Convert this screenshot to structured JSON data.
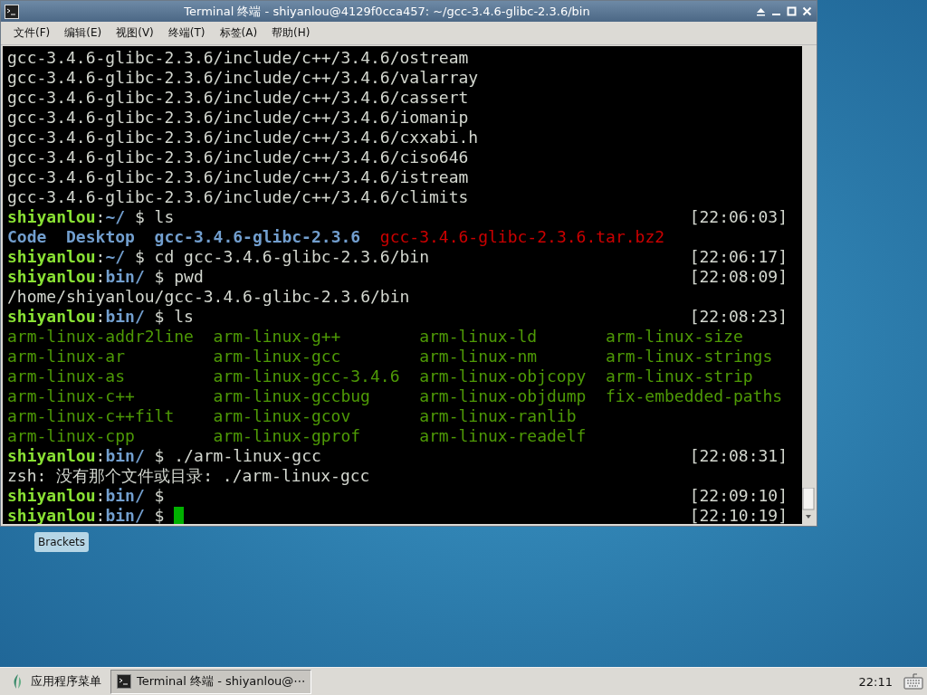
{
  "window": {
    "title": "Terminal 终端 - shiyanlou@4129f0cca457: ~/gcc-3.4.6-glibc-2.3.6/bin"
  },
  "menu": [
    "文件(F)",
    "编辑(E)",
    "视图(V)",
    "终端(T)",
    "标签(A)",
    "帮助(H)"
  ],
  "terminal": {
    "lines": [
      {
        "kind": "output",
        "segments": [
          {
            "kind": "plain",
            "text": "gcc-3.4.6-glibc-2.3.6/include/c++/3.4.6/ostream"
          }
        ]
      },
      {
        "kind": "output",
        "segments": [
          {
            "kind": "plain",
            "text": "gcc-3.4.6-glibc-2.3.6/include/c++/3.4.6/valarray"
          }
        ]
      },
      {
        "kind": "output",
        "segments": [
          {
            "kind": "plain",
            "text": "gcc-3.4.6-glibc-2.3.6/include/c++/3.4.6/cassert"
          }
        ]
      },
      {
        "kind": "output",
        "segments": [
          {
            "kind": "plain",
            "text": "gcc-3.4.6-glibc-2.3.6/include/c++/3.4.6/iomanip"
          }
        ]
      },
      {
        "kind": "output",
        "segments": [
          {
            "kind": "plain",
            "text": "gcc-3.4.6-glibc-2.3.6/include/c++/3.4.6/cxxabi.h"
          }
        ]
      },
      {
        "kind": "output",
        "segments": [
          {
            "kind": "plain",
            "text": "gcc-3.4.6-glibc-2.3.6/include/c++/3.4.6/ciso646"
          }
        ]
      },
      {
        "kind": "output",
        "segments": [
          {
            "kind": "plain",
            "text": "gcc-3.4.6-glibc-2.3.6/include/c++/3.4.6/istream"
          }
        ]
      },
      {
        "kind": "output",
        "segments": [
          {
            "kind": "plain",
            "text": "gcc-3.4.6-glibc-2.3.6/include/c++/3.4.6/climits"
          }
        ]
      },
      {
        "kind": "prompt",
        "user": "shiyanlou",
        "sep": ":",
        "dir": "~/",
        "command": "$ ls",
        "time": "[22:06:03]",
        "cursor": false
      },
      {
        "kind": "listing",
        "segments": [
          {
            "kind": "dir",
            "text": "Code"
          },
          {
            "kind": "dir",
            "text": "Desktop"
          },
          {
            "kind": "dir",
            "text": "gcc-3.4.6-glibc-2.3.6"
          },
          {
            "kind": "archive",
            "text": "gcc-3.4.6-glibc-2.3.6.tar.bz2"
          }
        ]
      },
      {
        "kind": "prompt",
        "user": "shiyanlou",
        "sep": ":",
        "dir": "~/",
        "command": "$ cd gcc-3.4.6-glibc-2.3.6/bin",
        "time": "[22:06:17]",
        "cursor": false
      },
      {
        "kind": "prompt",
        "user": "shiyanlou",
        "sep": ":",
        "dir": "bin/",
        "command": "$ pwd",
        "time": "[22:08:09]",
        "cursor": false
      },
      {
        "kind": "output",
        "segments": [
          {
            "kind": "plain",
            "text": "/home/shiyanlou/gcc-3.4.6-glibc-2.3.6/bin"
          }
        ]
      },
      {
        "kind": "prompt",
        "user": "shiyanlou",
        "sep": ":",
        "dir": "bin/",
        "command": "$ ls",
        "time": "[22:08:23]",
        "cursor": false
      },
      {
        "kind": "grid",
        "segments": [
          {
            "kind": "exec",
            "text": "arm-linux-addr2line"
          },
          {
            "kind": "exec",
            "text": "arm-linux-g++"
          },
          {
            "kind": "exec",
            "text": "arm-linux-ld"
          },
          {
            "kind": "exec",
            "text": "arm-linux-size"
          }
        ]
      },
      {
        "kind": "grid",
        "segments": [
          {
            "kind": "exec",
            "text": "arm-linux-ar"
          },
          {
            "kind": "exec",
            "text": "arm-linux-gcc"
          },
          {
            "kind": "exec",
            "text": "arm-linux-nm"
          },
          {
            "kind": "exec",
            "text": "arm-linux-strings"
          }
        ]
      },
      {
        "kind": "grid",
        "segments": [
          {
            "kind": "exec",
            "text": "arm-linux-as"
          },
          {
            "kind": "exec",
            "text": "arm-linux-gcc-3.4.6"
          },
          {
            "kind": "exec",
            "text": "arm-linux-objcopy"
          },
          {
            "kind": "exec",
            "text": "arm-linux-strip"
          }
        ]
      },
      {
        "kind": "grid",
        "segments": [
          {
            "kind": "exec",
            "text": "arm-linux-c++"
          },
          {
            "kind": "exec",
            "text": "arm-linux-gccbug"
          },
          {
            "kind": "exec",
            "text": "arm-linux-objdump"
          },
          {
            "kind": "exec",
            "text": "fix-embedded-paths"
          }
        ]
      },
      {
        "kind": "grid",
        "segments": [
          {
            "kind": "exec",
            "text": "arm-linux-c++filt"
          },
          {
            "kind": "exec",
            "text": "arm-linux-gcov"
          },
          {
            "kind": "exec",
            "text": "arm-linux-ranlib"
          }
        ]
      },
      {
        "kind": "grid",
        "segments": [
          {
            "kind": "exec",
            "text": "arm-linux-cpp"
          },
          {
            "kind": "exec",
            "text": "arm-linux-gprof"
          },
          {
            "kind": "exec",
            "text": "arm-linux-readelf"
          }
        ]
      },
      {
        "kind": "prompt",
        "user": "shiyanlou",
        "sep": ":",
        "dir": "bin/",
        "command": "$ ./arm-linux-gcc",
        "time": "[22:08:31]",
        "cursor": false
      },
      {
        "kind": "output",
        "segments": [
          {
            "kind": "plain",
            "text": "zsh: 没有那个文件或目录: ./arm-linux-gcc"
          }
        ]
      },
      {
        "kind": "prompt",
        "user": "shiyanlou",
        "sep": ":",
        "dir": "bin/",
        "command": "$",
        "time": "[22:09:10]",
        "cursor": false
      },
      {
        "kind": "prompt",
        "user": "shiyanlou",
        "sep": ":",
        "dir": "bin/",
        "command": "$",
        "time": "[22:10:19]",
        "cursor": true
      }
    ]
  },
  "desktop_icons": [
    {
      "label": "Brackets"
    }
  ],
  "taskbar": {
    "menu_label": "应用程序菜单",
    "tasks": [
      {
        "label": "Terminal 终端 - shiyanlou@⋯",
        "selected": true
      }
    ],
    "clock": "22:11"
  }
}
